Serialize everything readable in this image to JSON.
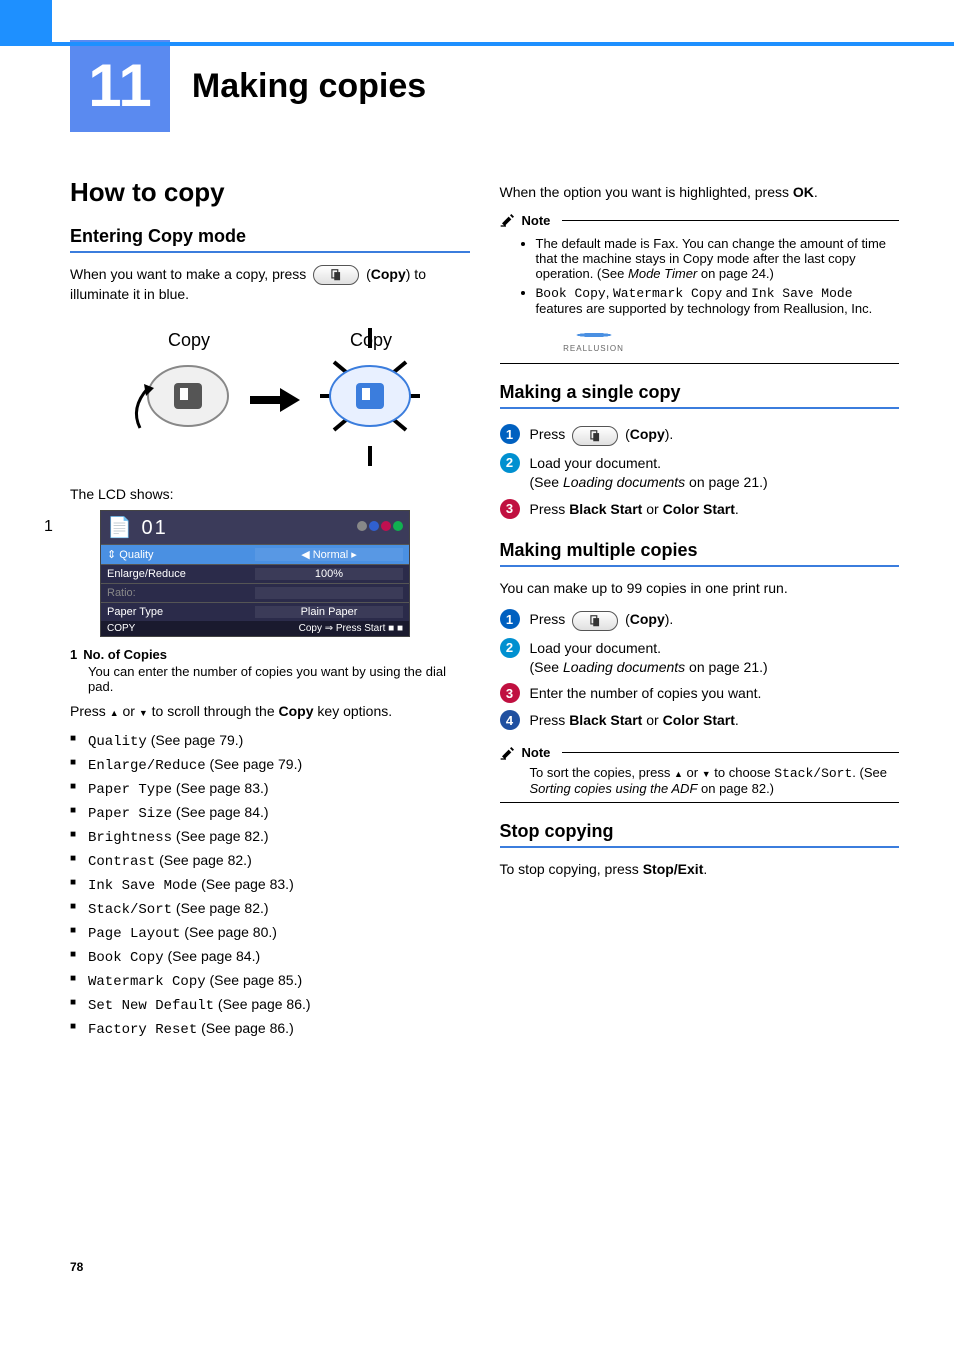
{
  "chapter": {
    "number": "11",
    "title": "Making copies"
  },
  "left": {
    "h1": "How to copy",
    "entering": {
      "heading": "Entering Copy mode",
      "p1a": "When you want to make a copy, press ",
      "p1b": " (",
      "p1c": "Copy",
      "p1d": ") to illuminate it in blue.",
      "copy_label": "Copy",
      "lcd_intro": "The LCD shows:",
      "callout": "1",
      "lcd": {
        "header_num": "01",
        "rows": [
          {
            "l": "Quality",
            "r": "◀ Normal",
            "sel": true
          },
          {
            "l": "Enlarge/Reduce",
            "r": "100%"
          },
          {
            "l": "Ratio:",
            "r": "",
            "dim": true
          },
          {
            "l": "Paper Type",
            "r": "Plain Paper"
          }
        ],
        "footer_l": "COPY",
        "footer_r": "Copy ⇒ Press Start"
      },
      "def_num": "1",
      "def_title": "No. of Copies",
      "def_desc": "You can enter the number of copies you want by using the dial pad.",
      "scroll_a": "Press ",
      "scroll_b": " or ",
      "scroll_c": " to scroll through the ",
      "scroll_d": "Copy",
      "scroll_e": " key options.",
      "options": [
        {
          "name": "Quality",
          "ref": " (See page 79.)"
        },
        {
          "name": "Enlarge/Reduce",
          "ref": " (See page 79.)"
        },
        {
          "name": "Paper Type",
          "ref": " (See page 83.)"
        },
        {
          "name": "Paper Size",
          "ref": " (See page 84.)"
        },
        {
          "name": "Brightness",
          "ref": " (See page 82.)"
        },
        {
          "name": "Contrast",
          "ref": " (See page 82.)"
        },
        {
          "name": "Ink Save Mode",
          "ref": " (See page 83.)"
        },
        {
          "name": "Stack/Sort",
          "ref": " (See page 82.)"
        },
        {
          "name": "Page Layout",
          "ref": " (See page 80.)"
        },
        {
          "name": "Book Copy",
          "ref": " (See page 84.)"
        },
        {
          "name": "Watermark Copy",
          "ref": " (See page 85.)"
        },
        {
          "name": "Set New Default",
          "ref": " (See page 86.)"
        },
        {
          "name": "Factory Reset",
          "ref": " (See page 86.)"
        }
      ]
    }
  },
  "right": {
    "highlight_a": "When the option you want is highlighted, press ",
    "highlight_b": "OK",
    "highlight_c": ".",
    "note1": {
      "label": "Note",
      "b1_a": "The default made is Fax. You can change the amount of time that the machine stays in Copy mode after the last copy operation. (See ",
      "b1_b": "Mode Timer",
      "b1_c": " on page 24.)",
      "b2_a": "Book Copy",
      "b2_b": ", ",
      "b2_c": "Watermark Copy",
      "b2_d": " and ",
      "b2_e": "Ink Save Mode",
      "b2_f": " features are supported by technology from Reallusion, Inc.",
      "logo_text": "REALLUSION"
    },
    "single": {
      "heading": "Making a single copy",
      "s1a": "Press ",
      "s1b": " (",
      "s1c": "Copy",
      "s1d": ").",
      "s2a": "Load your document.",
      "s2b": "(See ",
      "s2c": "Loading documents",
      "s2d": " on page 21.)",
      "s3a": "Press ",
      "s3b": "Black Start",
      "s3c": " or ",
      "s3d": "Color Start",
      "s3e": "."
    },
    "multiple": {
      "heading": "Making multiple copies",
      "intro": "You can make up to 99 copies in one print run.",
      "s1a": "Press ",
      "s1b": " (",
      "s1c": "Copy",
      "s1d": ").",
      "s2a": "Load your document.",
      "s2b": "(See ",
      "s2c": "Loading documents",
      "s2d": " on page 21.)",
      "s3": "Enter the number of copies you want.",
      "s4a": "Press ",
      "s4b": "Black Start",
      "s4c": " or ",
      "s4d": "Color Start",
      "s4e": "."
    },
    "note2": {
      "label": "Note",
      "a": "To sort the copies, press ",
      "b": " or ",
      "c": " to choose ",
      "d": "Stack/Sort",
      "e": ". (See ",
      "f": "Sorting copies using the ADF",
      "g": " on page 82.)"
    },
    "stop": {
      "heading": "Stop copying",
      "a": "To stop copying, press ",
      "b": "Stop/Exit",
      "c": "."
    }
  },
  "page_number": "78"
}
